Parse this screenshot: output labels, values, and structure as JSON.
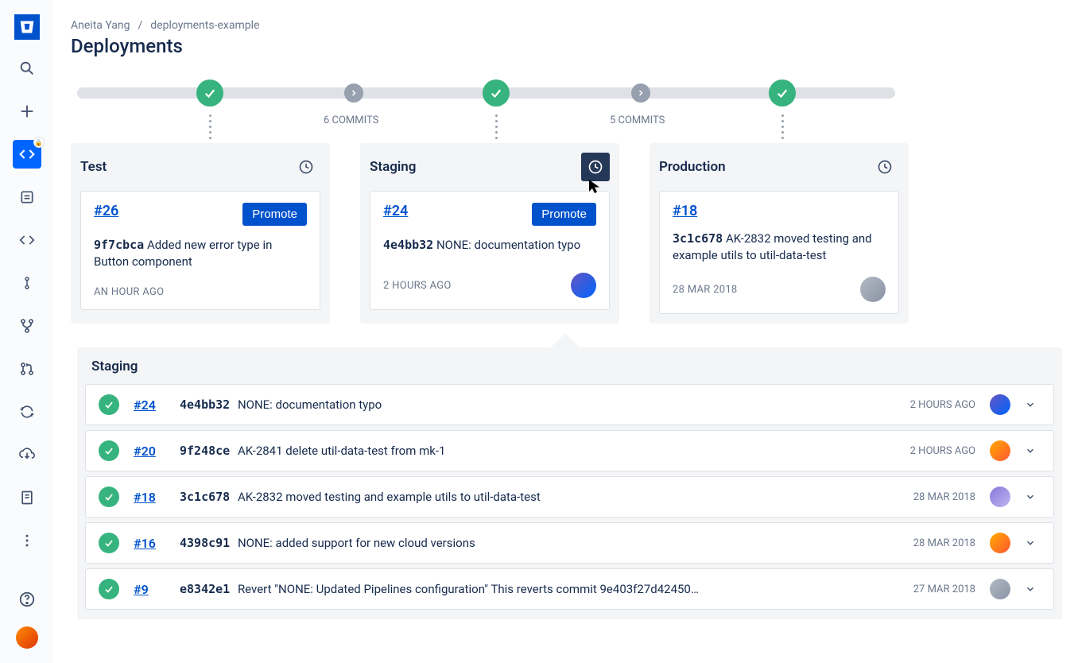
{
  "breadcrumb": {
    "owner": "Aneita Yang",
    "repo": "deployments-example"
  },
  "page_title": "Deployments",
  "pipeline": {
    "commits_a": "6 COMMITS",
    "commits_b": "5 COMMITS"
  },
  "environments": [
    {
      "name": "Test",
      "build": "#26",
      "hash": "9f7cbca",
      "message": "Added new error type in Button component",
      "time": "AN HOUR AGO",
      "promote": "Promote",
      "avatar": "",
      "historyActive": false
    },
    {
      "name": "Staging",
      "build": "#24",
      "hash": "4e4bb32",
      "message": "NONE: documentation typo",
      "time": "2 HOURS AGO",
      "promote": "Promote",
      "avatar": "av1",
      "historyActive": true
    },
    {
      "name": "Production",
      "build": "#18",
      "hash": "3c1c678",
      "message": "AK-2832 moved testing and example utils to util-data-test",
      "time": "28 MAR 2018",
      "promote": "",
      "avatar": "av5",
      "historyActive": false
    }
  ],
  "history": {
    "title": "Staging",
    "rows": [
      {
        "build": "#24",
        "hash": "4e4bb32",
        "message": "NONE: documentation typo",
        "time": "2 HOURS AGO",
        "avatar": "av1"
      },
      {
        "build": "#20",
        "hash": "9f248ce",
        "message": "AK-2841 delete util-data-test from mk-1",
        "time": "2 HOURS AGO",
        "avatar": "av3"
      },
      {
        "build": "#18",
        "hash": "3c1c678",
        "message": "AK-2832 moved testing and example utils to util-data-test",
        "time": "28 MAR 2018",
        "avatar": "av4"
      },
      {
        "build": "#16",
        "hash": "4398c91",
        "message": "NONE: added support for new cloud versions",
        "time": "28 MAR 2018",
        "avatar": "av3"
      },
      {
        "build": "#9",
        "hash": "e8342e1",
        "message": "Revert \"NONE: Updated Pipelines configuration\" This reverts commit 9e403f27d42450…",
        "time": "27 MAR 2018",
        "avatar": "av5"
      }
    ]
  }
}
